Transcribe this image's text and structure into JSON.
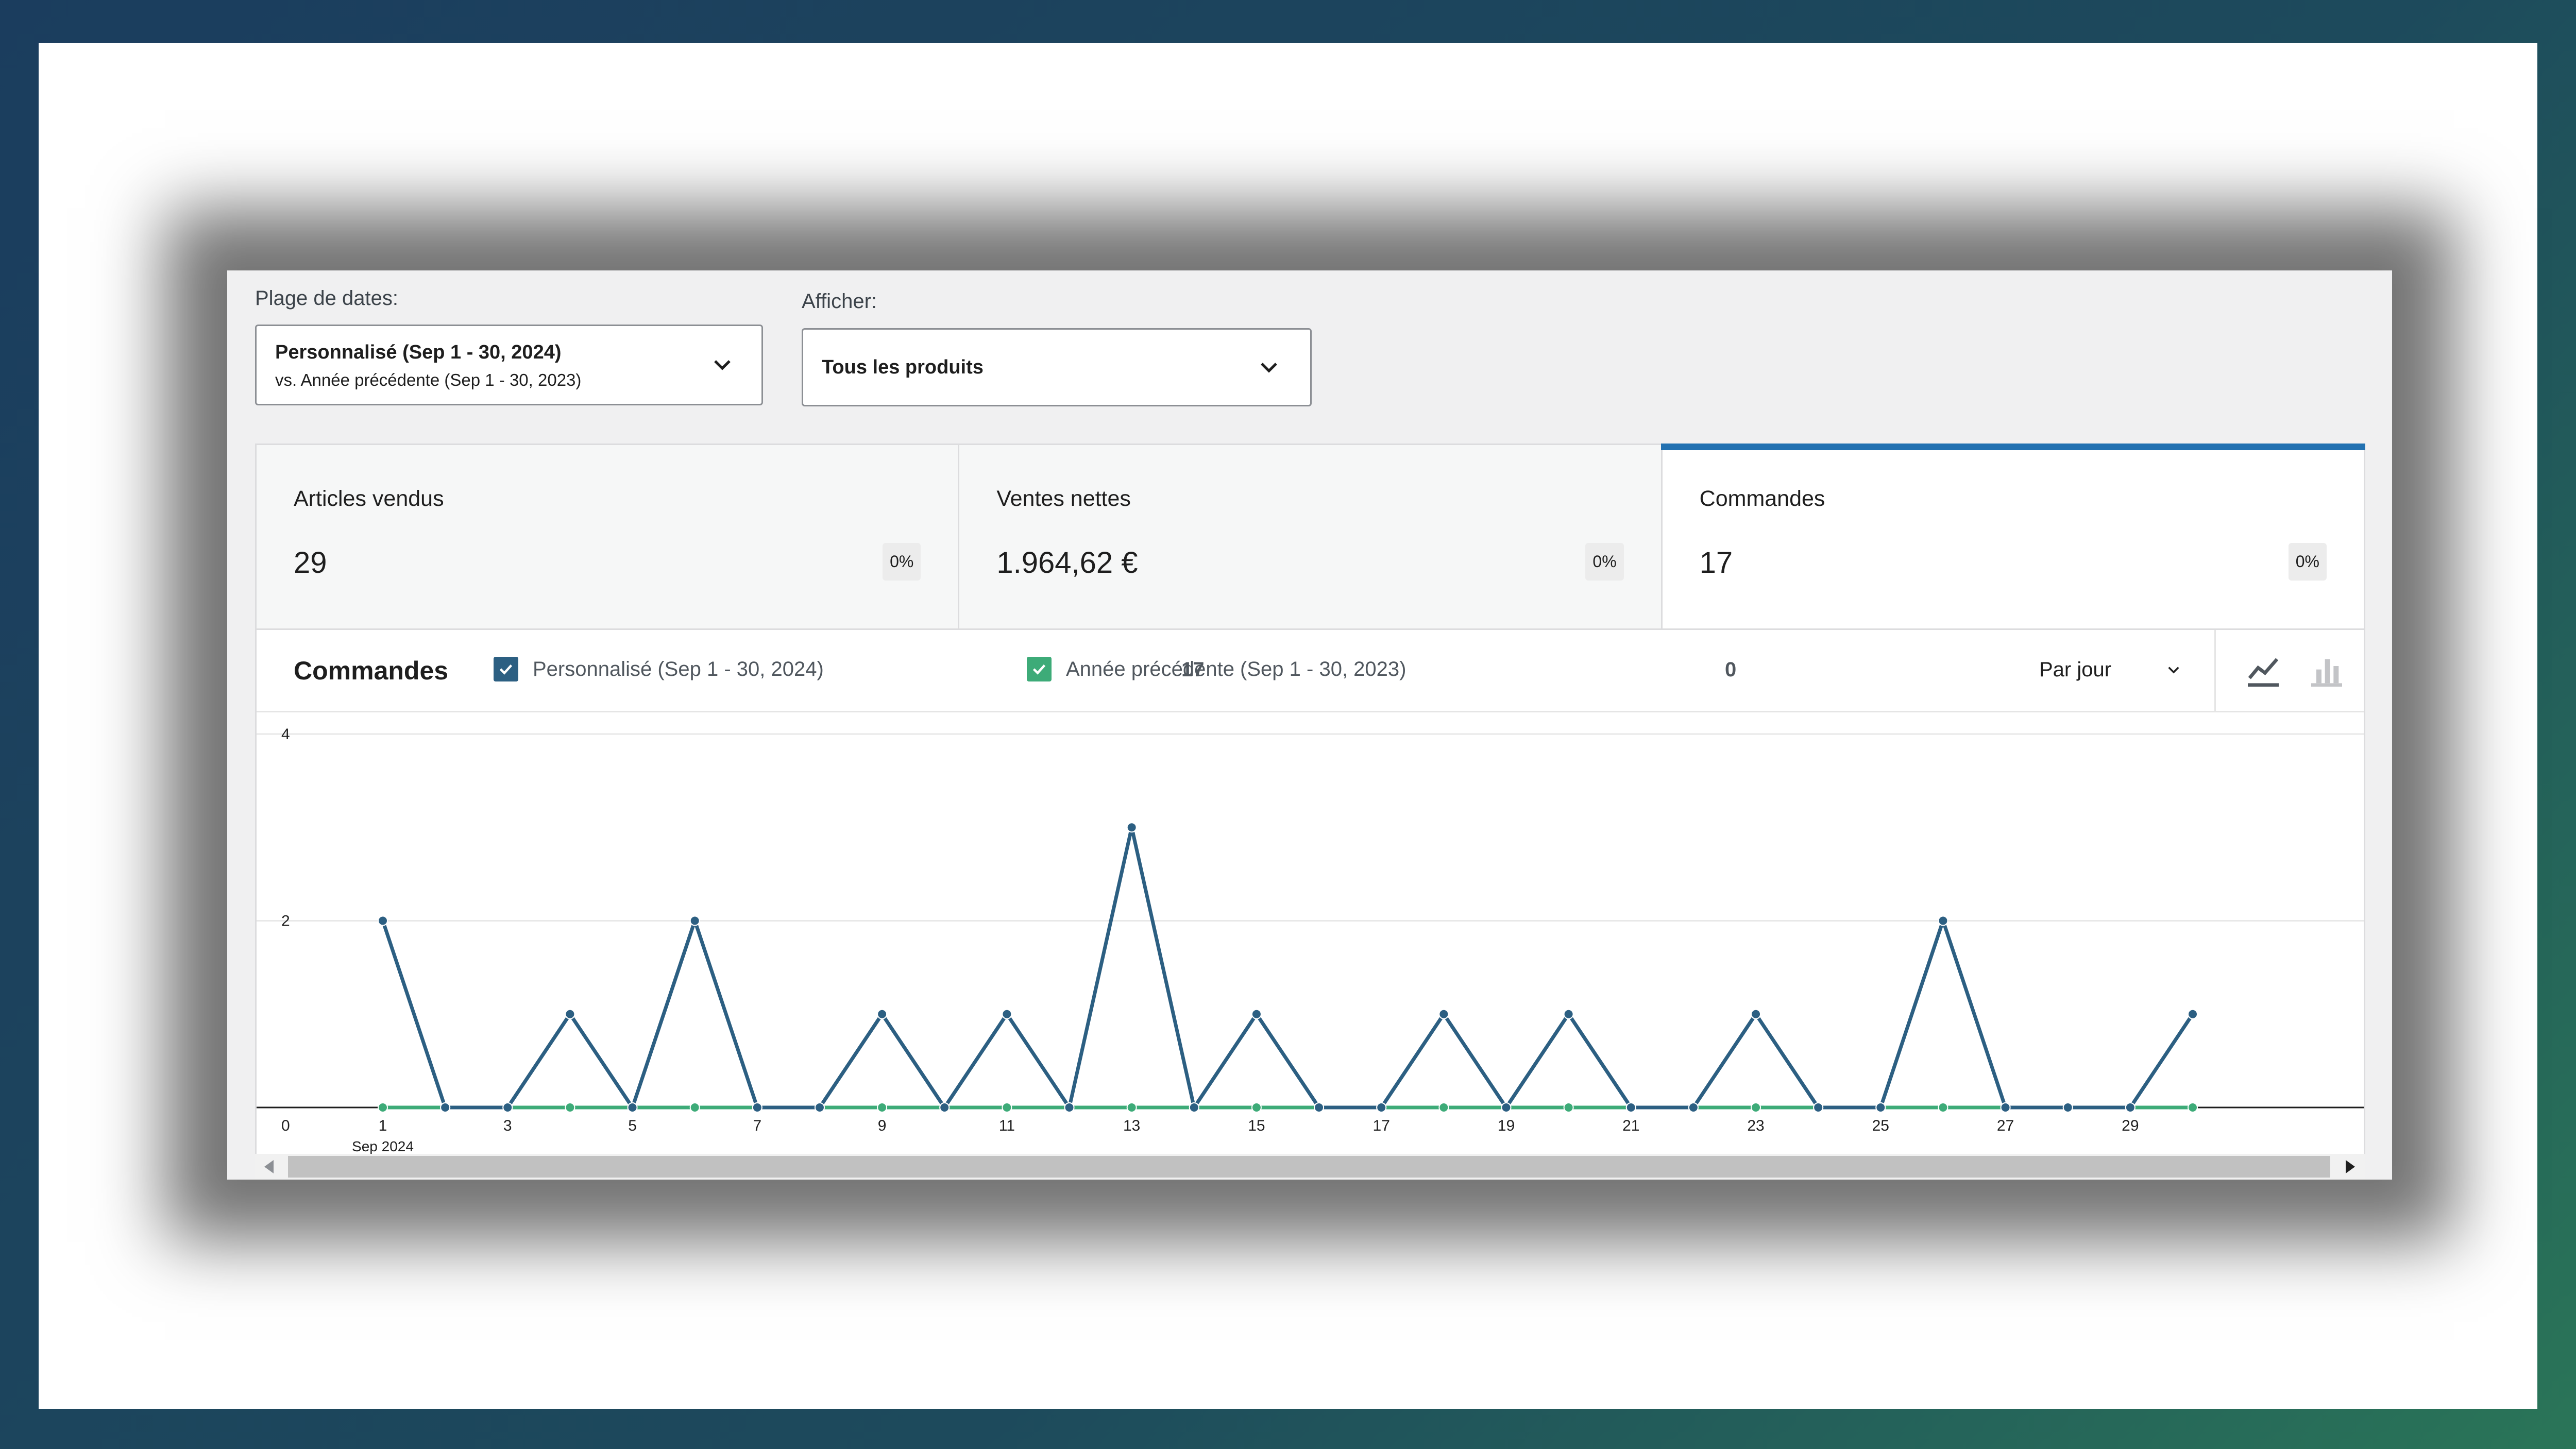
{
  "filters": {
    "date_range_label": "Plage de dates:",
    "date_range_primary": "Personnalisé (Sep 1 - 30, 2024)",
    "date_range_secondary": "vs. Année précédente (Sep 1 - 30, 2023)",
    "show_label": "Afficher:",
    "show_value": "Tous les produits"
  },
  "summary": [
    {
      "label": "Articles vendus",
      "value": "29",
      "delta": "0%"
    },
    {
      "label": "Ventes nettes",
      "value": "1.964,62 €",
      "delta": "0%"
    },
    {
      "label": "Commandes",
      "value": "17",
      "delta": "0%",
      "active": true
    }
  ],
  "chart_header": {
    "title": "Commandes",
    "legend": [
      {
        "label": "Personnalisé (Sep 1 - 30, 2024)",
        "total": "17",
        "color": "#2c5f82",
        "checked": true
      },
      {
        "label": "Année précédente (Sep 1 - 30, 2023)",
        "total": "0",
        "color": "#3dab78",
        "checked": true
      }
    ],
    "interval": "Par jour",
    "chart_types": [
      "line-chart-icon",
      "bar-chart-icon"
    ]
  },
  "chart_data": {
    "type": "line",
    "x": [
      1,
      2,
      3,
      4,
      5,
      6,
      7,
      8,
      9,
      10,
      11,
      12,
      13,
      14,
      15,
      16,
      17,
      18,
      19,
      20,
      21,
      22,
      23,
      24,
      25,
      26,
      27,
      28,
      29,
      30
    ],
    "x_tick_labels": [
      "1",
      "3",
      "5",
      "7",
      "9",
      "11",
      "13",
      "15",
      "17",
      "19",
      "21",
      "23",
      "25",
      "27",
      "29"
    ],
    "x_sublabel": "Sep 2024",
    "y_ticks": [
      "0",
      "2",
      "4"
    ],
    "ylim": [
      0,
      4
    ],
    "series": [
      {
        "name": "Personnalisé (Sep 1 - 30, 2024)",
        "color": "#2c5f82",
        "values": [
          2,
          0,
          0,
          1,
          0,
          2,
          0,
          0,
          1,
          0,
          1,
          0,
          3,
          0,
          1,
          0,
          0,
          1,
          0,
          1,
          0,
          0,
          1,
          0,
          0,
          2,
          0,
          0,
          0,
          1
        ]
      },
      {
        "name": "Année précédente (Sep 1 - 30, 2023)",
        "color": "#3dab78",
        "values": [
          0,
          0,
          0,
          0,
          0,
          0,
          0,
          0,
          0,
          0,
          0,
          0,
          0,
          0,
          0,
          0,
          0,
          0,
          0,
          0,
          0,
          0,
          0,
          0,
          0,
          0,
          0,
          0,
          0,
          0
        ]
      }
    ],
    "grid": true
  }
}
